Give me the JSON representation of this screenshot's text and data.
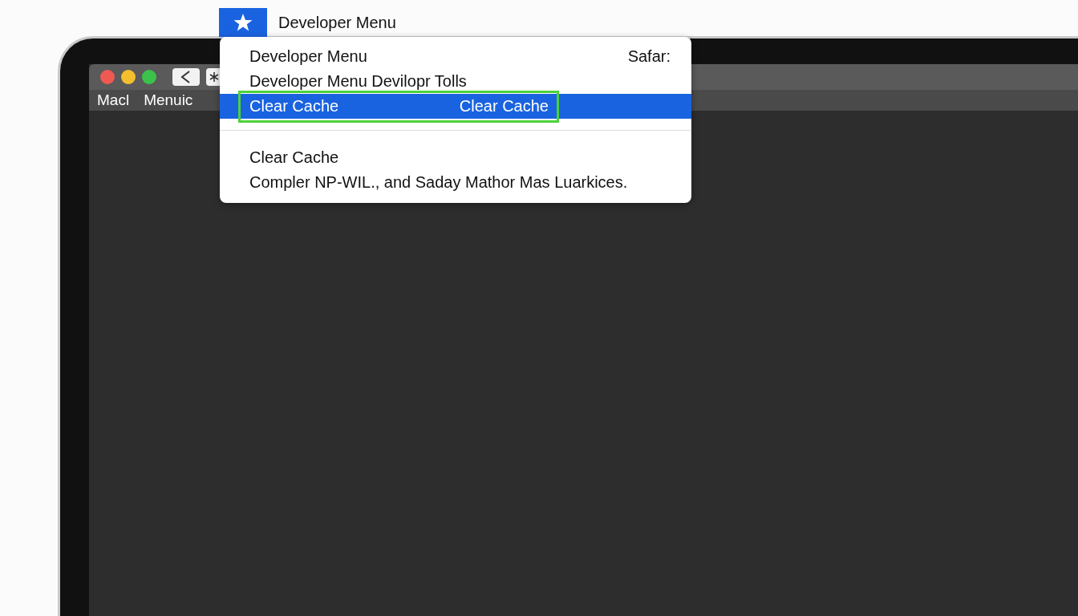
{
  "top_menu": {
    "title": "Developer Menu"
  },
  "browser_menu": [
    "Macl",
    "Menuic"
  ],
  "dropdown": {
    "items": [
      {
        "kind": "item",
        "label": "Developer Menu",
        "shortcut": "Safar:",
        "selected": false,
        "outlined": false
      },
      {
        "kind": "item",
        "label": "Developer Menu Devilopr Tolls",
        "selected": false,
        "outlined": false
      },
      {
        "kind": "item",
        "label": "Clear Cache",
        "shortcut": "Clear Cache",
        "selected": true,
        "outlined": true
      },
      {
        "kind": "separator"
      },
      {
        "kind": "item",
        "label": "Clear Cache",
        "selected": false,
        "outlined": false
      },
      {
        "kind": "item",
        "label": "Compler NP-WIL., and Saday Mathor Mas Luarkices.",
        "selected": false,
        "outlined": false
      }
    ]
  }
}
